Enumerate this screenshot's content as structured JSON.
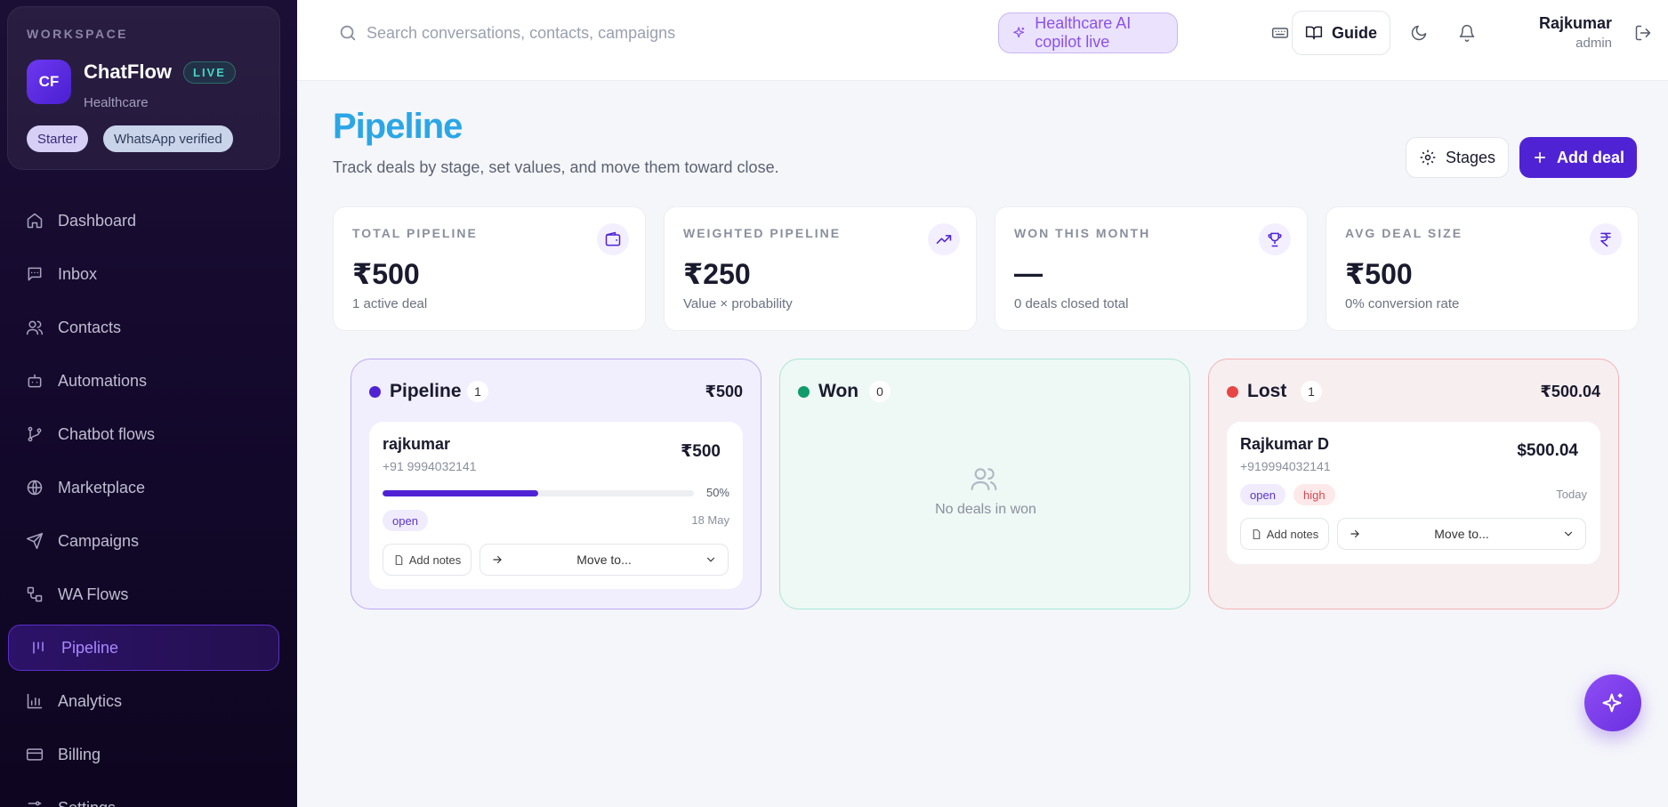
{
  "workspace": {
    "label": "WORKSPACE",
    "logo_text": "CF",
    "name": "ChatFlow",
    "live_badge": "LIVE",
    "subtitle": "Healthcare",
    "badges": [
      "Starter",
      "WhatsApp verified"
    ]
  },
  "sidebar": {
    "items": [
      {
        "label": "Dashboard",
        "icon": "home-icon"
      },
      {
        "label": "Inbox",
        "icon": "message-icon"
      },
      {
        "label": "Contacts",
        "icon": "users-icon"
      },
      {
        "label": "Automations",
        "icon": "bot-icon"
      },
      {
        "label": "Chatbot flows",
        "icon": "git-branch-icon"
      },
      {
        "label": "Marketplace",
        "icon": "globe-icon"
      },
      {
        "label": "Campaigns",
        "icon": "send-icon"
      },
      {
        "label": "WA Flows",
        "icon": "workflow-icon"
      },
      {
        "label": "Pipeline",
        "icon": "kanban-icon",
        "active": true
      },
      {
        "label": "Analytics",
        "icon": "bar-chart-icon"
      },
      {
        "label": "Billing",
        "icon": "credit-card-icon"
      },
      {
        "label": "Settings",
        "icon": "settings-icon"
      }
    ]
  },
  "topbar": {
    "search_placeholder": "Search conversations, contacts, campaigns",
    "copilot_label": "Healthcare AI copilot live",
    "guide_label": "Guide",
    "user_name": "Rajkumar",
    "user_role": "admin"
  },
  "page": {
    "title": "Pipeline",
    "subtitle": "Track deals by stage, set values, and move them toward close.",
    "stages_label": "Stages",
    "add_deal_label": "Add deal"
  },
  "stats": [
    {
      "label": "TOTAL PIPELINE",
      "value": "₹500",
      "sub": "1 active deal",
      "icon": "wallet-icon"
    },
    {
      "label": "WEIGHTED PIPELINE",
      "value": "₹250",
      "sub": "Value × probability",
      "icon": "trending-up-icon"
    },
    {
      "label": "WON THIS MONTH",
      "value": "—",
      "sub": "0 deals closed total",
      "icon": "trophy-icon"
    },
    {
      "label": "AVG DEAL SIZE",
      "value": "₹500",
      "sub": "0% conversion rate",
      "icon": "rupee-icon"
    }
  ],
  "columns": {
    "pipeline": {
      "title": "Pipeline",
      "count": "1",
      "total": "₹500",
      "color": "#4f23d4",
      "deal": {
        "name": "rajkumar",
        "phone": "+91 9994032141",
        "amount": "₹500",
        "probability_label": "50%",
        "probability": 0.5,
        "tags": [
          "open"
        ],
        "date": "18 May",
        "notes_label": "Add notes",
        "move_label": "Move to..."
      }
    },
    "won": {
      "title": "Won",
      "count": "0",
      "color": "#0f9b6a",
      "empty_text": "No deals in won"
    },
    "lost": {
      "title": "Lost",
      "count": "1",
      "total": "₹500.04",
      "color": "#e84545",
      "deal": {
        "name": "Rajkumar D",
        "phone": "+919994032141",
        "amount": "$500.04",
        "tags": [
          "open",
          "high"
        ],
        "date": "Today",
        "notes_label": "Add notes",
        "move_label": "Move to..."
      }
    }
  }
}
